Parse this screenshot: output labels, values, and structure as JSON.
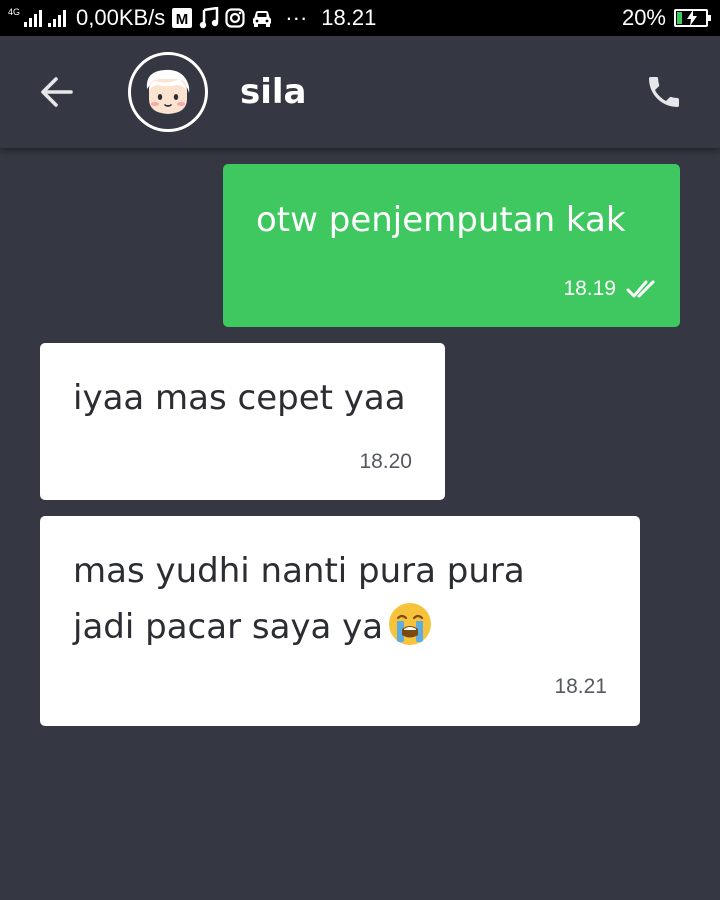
{
  "status_bar": {
    "network_type": "4G",
    "data_speed": "0,00KB/s",
    "clock": "18.21",
    "ellipsis": "···",
    "battery_percent": "20%",
    "battery_level": 0.2,
    "battery_charging": true,
    "icons": [
      "signal-icon",
      "signal-icon",
      "m-notification-icon",
      "music-note-icon",
      "instagram-icon",
      "car-icon",
      "battery-icon"
    ]
  },
  "header": {
    "back_icon": "arrow-left-icon",
    "avatar_icon": "avatar-face-icon",
    "contact_name": "sila",
    "call_icon": "phone-icon"
  },
  "messages": [
    {
      "direction": "outgoing",
      "text": "otw penjemputan kak",
      "time": "18.19",
      "read": true
    },
    {
      "direction": "incoming",
      "text": "iyaa mas cepet yaa",
      "time": "18.20"
    },
    {
      "direction": "incoming",
      "text": "mas yudhi nanti pura pura\njadi pacar saya ya",
      "emoji": "loudly-crying-face-emoji",
      "time": "18.21"
    }
  ],
  "colors": {
    "background": "#353842",
    "outgoing_bubble": "#3ec85f",
    "incoming_bubble": "#ffffff",
    "status_bar": "#000000"
  }
}
